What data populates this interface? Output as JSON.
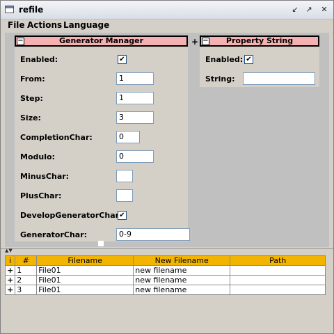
{
  "window": {
    "title": "refile",
    "buttons": [
      "minimize",
      "maximize",
      "close"
    ]
  },
  "menu": [
    "File",
    "Actions",
    "Language"
  ],
  "generator_manager": {
    "title": "Generator Manager",
    "rows": [
      {
        "label": "Enabled:",
        "type": "checkbox",
        "checked": true
      },
      {
        "label": "From:",
        "type": "text",
        "value": "1"
      },
      {
        "label": "Step:",
        "type": "text",
        "value": "1"
      },
      {
        "label": "Size:",
        "type": "text",
        "value": "3"
      },
      {
        "label": "CompletionChar:",
        "type": "text",
        "value": "0"
      },
      {
        "label": "Modulo:",
        "type": "text",
        "value": "0"
      },
      {
        "label": "MinusChar:",
        "type": "text",
        "value": ""
      },
      {
        "label": "PlusChar:",
        "type": "text",
        "value": ""
      },
      {
        "label": "DevelopGeneratorChar:",
        "type": "checkbox",
        "checked": true
      },
      {
        "label": "GeneratorChar:",
        "type": "text",
        "value": "0-9"
      }
    ]
  },
  "add_panel_button": "+",
  "property_string": {
    "title": "Property String",
    "enabled_label": "Enabled:",
    "enabled_checked": true,
    "string_label": "String:",
    "string_value": ""
  },
  "file_table": {
    "columns": [
      "i",
      "#",
      "Filename",
      "New Filename",
      "Path"
    ],
    "rows": [
      {
        "marker": "+",
        "num": "1",
        "filename": "File01",
        "new_filename": "new filename",
        "path": ""
      },
      {
        "marker": "+",
        "num": "2",
        "filename": "File01",
        "new_filename": "new filename",
        "path": ""
      },
      {
        "marker": "+",
        "num": "3",
        "filename": "File01",
        "new_filename": "new filename",
        "path": ""
      }
    ]
  },
  "colors": {
    "panel_header": "#f5b1b1",
    "table_header": "#f3b400"
  }
}
